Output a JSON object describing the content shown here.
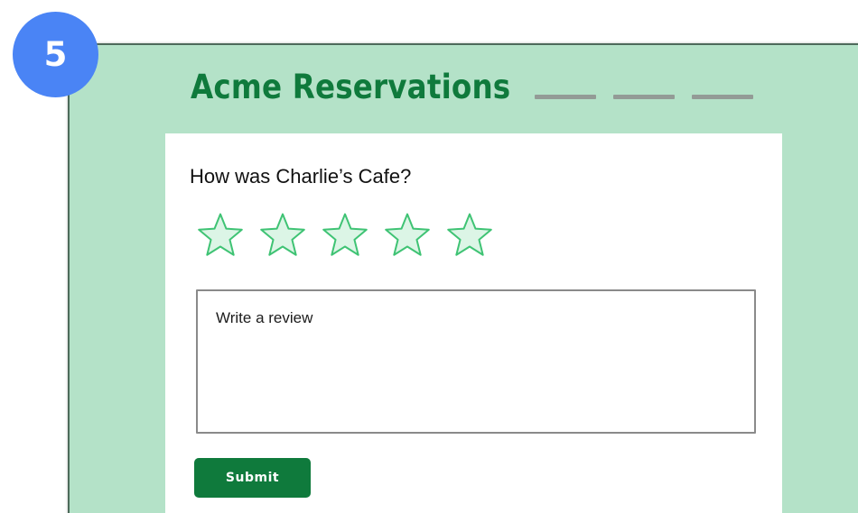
{
  "step_badge": {
    "number": "5",
    "color": "#4a84f5"
  },
  "header": {
    "brand": "Acme Reservations",
    "nav_items": [
      "",
      "",
      ""
    ]
  },
  "review_form": {
    "question": "How was Charlie’s Cafe?",
    "rating": {
      "max_stars": 5,
      "selected": 0,
      "star_fill": "#dcf5e6",
      "star_stroke": "#3fc374"
    },
    "review_placeholder": "Write a review",
    "submit_label": "Submit"
  },
  "colors": {
    "page_background": "#b4e2c8",
    "brand_green": "#0f7a3c",
    "card_background": "#ffffff"
  }
}
